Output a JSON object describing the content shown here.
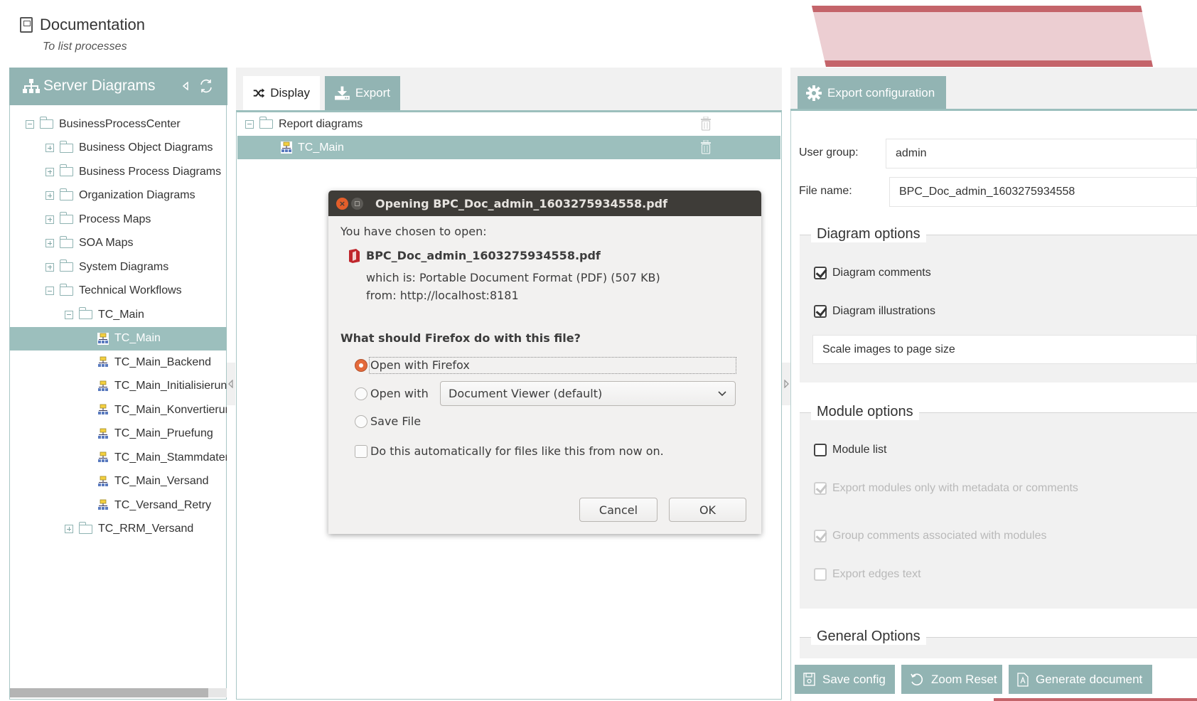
{
  "page": {
    "title": "Documentation",
    "subtitle": "To list processes"
  },
  "left_panel": {
    "title": "Server Diagrams",
    "tree": [
      {
        "label": "BusinessProcessCenter",
        "type": "folder",
        "state": "expanded",
        "level": 0
      },
      {
        "label": "Business Object Diagrams",
        "type": "folder",
        "state": "collapsed",
        "level": 1
      },
      {
        "label": "Business Process Diagrams",
        "type": "folder",
        "state": "collapsed",
        "level": 1
      },
      {
        "label": "Organization Diagrams",
        "type": "folder",
        "state": "collapsed",
        "level": 1
      },
      {
        "label": "Process Maps",
        "type": "folder",
        "state": "collapsed",
        "level": 1
      },
      {
        "label": "SOA Maps",
        "type": "folder",
        "state": "collapsed",
        "level": 1
      },
      {
        "label": "System Diagrams",
        "type": "folder",
        "state": "collapsed",
        "level": 1
      },
      {
        "label": "Technical Workflows",
        "type": "folder",
        "state": "expanded",
        "level": 1
      },
      {
        "label": "TC_Main",
        "type": "folder",
        "state": "expanded",
        "level": 2
      },
      {
        "label": "TC_Main",
        "type": "diagram",
        "selected": true,
        "level": 3
      },
      {
        "label": "TC_Main_Backend",
        "type": "diagram",
        "level": 3
      },
      {
        "label": "TC_Main_Initialisierun",
        "type": "diagram",
        "level": 3
      },
      {
        "label": "TC_Main_Konvertierur",
        "type": "diagram",
        "level": 3
      },
      {
        "label": "TC_Main_Pruefung",
        "type": "diagram",
        "level": 3
      },
      {
        "label": "TC_Main_Stammdaten",
        "type": "diagram",
        "level": 3
      },
      {
        "label": "TC_Main_Versand",
        "type": "diagram",
        "level": 3
      },
      {
        "label": "TC_Versand_Retry",
        "type": "diagram",
        "level": 3
      },
      {
        "label": "TC_RRM_Versand",
        "type": "folder",
        "state": "collapsed",
        "level": 2
      }
    ]
  },
  "center_panel": {
    "tabs": [
      {
        "label": "Display",
        "active": false
      },
      {
        "label": "Export",
        "active": true
      }
    ],
    "list": [
      {
        "label": "Report diagrams",
        "type": "folder"
      },
      {
        "label": "TC_Main",
        "type": "diagram",
        "selected": true
      }
    ]
  },
  "right_panel": {
    "tab_label": "Export configuration",
    "user_group_label": "User group:",
    "user_group_value": "admin",
    "file_name_label": "File name:",
    "file_name_value": "BPC_Doc_admin_1603275934558",
    "diagram_options": {
      "legend": "Diagram options",
      "comments": {
        "label": "Diagram comments",
        "checked": true
      },
      "illustrations": {
        "label": "Diagram illustrations",
        "checked": true
      },
      "scale_select": "Scale images to page size"
    },
    "module_options": {
      "legend": "Module options",
      "module_list": {
        "label": "Module list",
        "checked": false
      },
      "only_with_metadata": {
        "label": "Export modules only with metadata or comments",
        "checked": true,
        "disabled": true
      },
      "group_comments": {
        "label": "Group comments associated with modules",
        "checked": true,
        "disabled": true
      },
      "edges_text": {
        "label": "Export edges text",
        "checked": false,
        "disabled": true
      }
    },
    "general_options": {
      "legend": "General Options"
    },
    "buttons": {
      "save_config": "Save config",
      "zoom_reset": "Zoom Reset",
      "generate_document": "Generate document"
    }
  },
  "dialog": {
    "title": "Opening BPC_Doc_admin_1603275934558.pdf",
    "intro": "You have chosen to open:",
    "file_name": "BPC_Doc_admin_1603275934558.pdf",
    "which_is": "which is: Portable Document Format (PDF) (507 KB)",
    "from": "from: http://localhost:8181",
    "question": "What should Firefox do with this file?",
    "options": {
      "open_with_firefox": "Open with Firefox",
      "open_with": "Open with",
      "open_with_app": "Document Viewer (default)",
      "save_file": "Save File"
    },
    "selected_option": "open_with_firefox",
    "auto_checkbox": "Do this automatically for files like this from now on.",
    "auto_checked": false,
    "cancel": "Cancel",
    "ok": "OK"
  },
  "colors": {
    "accent": "#92b4b3",
    "selected_row": "#9cbfbd",
    "banner_dark": "#c4646a",
    "banner_light": "#ecced2",
    "dialog_titlebar": "#3e3c38",
    "radio_active": "#e46a3b"
  }
}
